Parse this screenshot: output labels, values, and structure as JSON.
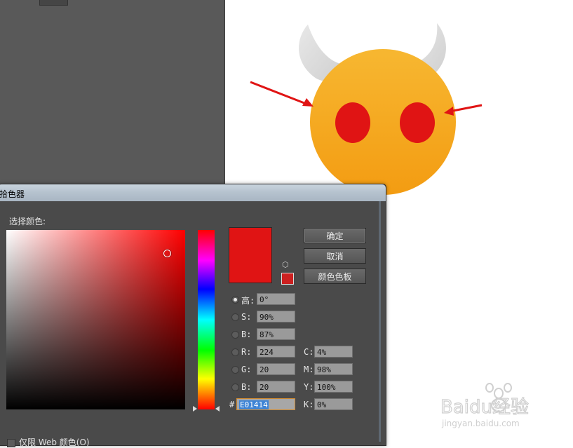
{
  "dialog": {
    "title": "拾色器",
    "select_color_label": "选择颜色:",
    "buttons": {
      "ok": "确定",
      "cancel": "取消",
      "swatches": "颜色色板"
    },
    "hsb": [
      {
        "label": "高:",
        "value": "0°",
        "selected": true
      },
      {
        "label": "S:",
        "value": "90%",
        "selected": false
      },
      {
        "label": "B:",
        "value": "87%",
        "selected": false
      }
    ],
    "rgb": [
      {
        "label": "R:",
        "value": "224"
      },
      {
        "label": "G:",
        "value": "20"
      },
      {
        "label": "B:",
        "value": "20"
      }
    ],
    "cmyk": [
      {
        "label": "C:",
        "value": "4%"
      },
      {
        "label": "M:",
        "value": "98%"
      },
      {
        "label": "Y:",
        "value": "100%"
      },
      {
        "label": "K:",
        "value": "0%"
      }
    ],
    "hex_label": "#",
    "hex_value": "E01414",
    "only_web_label": "仅限 Web 颜色(O)",
    "current_color": "#e01414",
    "web_safe_color": "#cc2020"
  },
  "canvas": {
    "face_color": "#f5a623",
    "eye_color": "#e01414",
    "horn_color": "#dcdcdc",
    "arrow_color": "#e01414"
  },
  "watermark": {
    "brand": "Baidu经验",
    "url": "jingyan.baidu.com"
  }
}
